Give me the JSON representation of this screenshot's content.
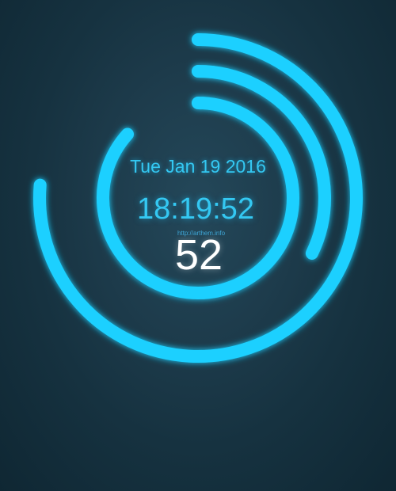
{
  "clock": {
    "date": "Tue Jan 19 2016",
    "time": "18:19:52",
    "url": "http://arthem.info",
    "seconds": "52",
    "accent_color": "#1fd0ff",
    "progress": {
      "hours": 0.763,
      "minutes": 0.322,
      "seconds": 0.867
    }
  }
}
